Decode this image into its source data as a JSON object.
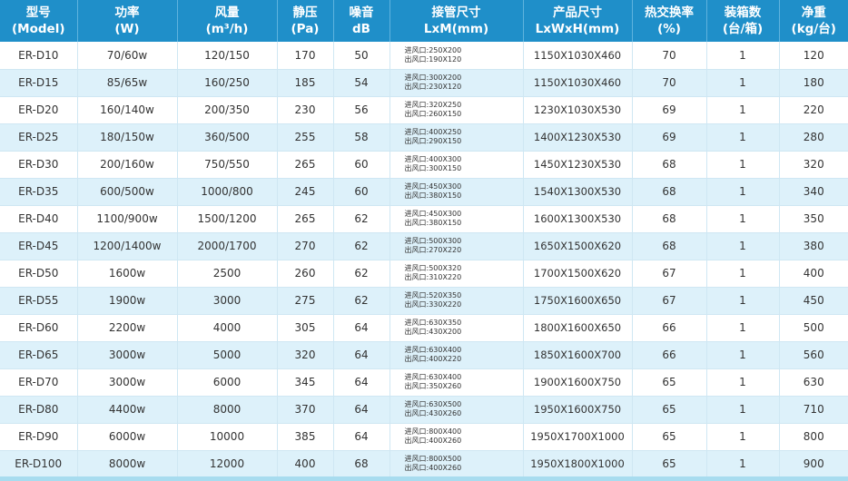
{
  "header": [
    {
      "top": "型号",
      "bottom": "(Model)"
    },
    {
      "top": "功率",
      "bottom": "(W)"
    },
    {
      "top": "风量",
      "bottom": "(m³/h)"
    },
    {
      "top": "静压",
      "bottom": "(Pa)"
    },
    {
      "top": "噪音",
      "bottom": "dB"
    },
    {
      "top": "接管尺寸",
      "bottom": "LxM(mm)"
    },
    {
      "top": "产品尺寸",
      "bottom": "LxWxH(mm)"
    },
    {
      "top": "热交换率",
      "bottom": "(%)"
    },
    {
      "top": "装箱数",
      "bottom": "(台/箱)"
    },
    {
      "top": "净重",
      "bottom": "(kg/台)"
    }
  ],
  "rows": [
    {
      "model": "ER-D10",
      "power": "70/60w",
      "airflow": "120/150",
      "pressure": "170",
      "noise": "50",
      "inlet": "进风口:250X200",
      "outlet": "出风口:190X120",
      "size": "1150X1030X460",
      "efficiency": "70",
      "pack": "1",
      "weight": "120"
    },
    {
      "model": "ER-D15",
      "power": "85/65w",
      "airflow": "160/250",
      "pressure": "185",
      "noise": "54",
      "inlet": "进风口:300X200",
      "outlet": "出风口:230X120",
      "size": "1150X1030X460",
      "efficiency": "70",
      "pack": "1",
      "weight": "180"
    },
    {
      "model": "ER-D20",
      "power": "160/140w",
      "airflow": "200/350",
      "pressure": "230",
      "noise": "56",
      "inlet": "进风口:320X250",
      "outlet": "出风口:260X150",
      "size": "1230X1030X530",
      "efficiency": "69",
      "pack": "1",
      "weight": "220"
    },
    {
      "model": "ER-D25",
      "power": "180/150w",
      "airflow": "360/500",
      "pressure": "255",
      "noise": "58",
      "inlet": "进风口:400X250",
      "outlet": "出风口:290X150",
      "size": "1400X1230X530",
      "efficiency": "69",
      "pack": "1",
      "weight": "280"
    },
    {
      "model": "ER-D30",
      "power": "200/160w",
      "airflow": "750/550",
      "pressure": "265",
      "noise": "60",
      "inlet": "进风口:400X300",
      "outlet": "出风口:300X150",
      "size": "1450X1230X530",
      "efficiency": "68",
      "pack": "1",
      "weight": "320"
    },
    {
      "model": "ER-D35",
      "power": "600/500w",
      "airflow": "1000/800",
      "pressure": "245",
      "noise": "60",
      "inlet": "进风口:450X300",
      "outlet": "出风口:380X150",
      "size": "1540X1300X530",
      "efficiency": "68",
      "pack": "1",
      "weight": "340"
    },
    {
      "model": "ER-D40",
      "power": "1100/900w",
      "airflow": "1500/1200",
      "pressure": "265",
      "noise": "62",
      "inlet": "进风口:450X300",
      "outlet": "出风口:380X150",
      "size": "1600X1300X530",
      "efficiency": "68",
      "pack": "1",
      "weight": "350"
    },
    {
      "model": "ER-D45",
      "power": "1200/1400w",
      "airflow": "2000/1700",
      "pressure": "270",
      "noise": "62",
      "inlet": "进风口:500X300",
      "outlet": "出风口:270X220",
      "size": "1650X1500X620",
      "efficiency": "68",
      "pack": "1",
      "weight": "380"
    },
    {
      "model": "ER-D50",
      "power": "1600w",
      "airflow": "2500",
      "pressure": "260",
      "noise": "62",
      "inlet": "进风口:500X320",
      "outlet": "出风口:310X220",
      "size": "1700X1500X620",
      "efficiency": "67",
      "pack": "1",
      "weight": "400"
    },
    {
      "model": "ER-D55",
      "power": "1900w",
      "airflow": "3000",
      "pressure": "275",
      "noise": "62",
      "inlet": "进风口:520X350",
      "outlet": "出风口:330X220",
      "size": "1750X1600X650",
      "efficiency": "67",
      "pack": "1",
      "weight": "450"
    },
    {
      "model": "ER-D60",
      "power": "2200w",
      "airflow": "4000",
      "pressure": "305",
      "noise": "64",
      "inlet": "进风口:630X350",
      "outlet": "出风口:430X200",
      "size": "1800X1600X650",
      "efficiency": "66",
      "pack": "1",
      "weight": "500"
    },
    {
      "model": "ER-D65",
      "power": "3000w",
      "airflow": "5000",
      "pressure": "320",
      "noise": "64",
      "inlet": "进风口:630X400",
      "outlet": "出风口:400X220",
      "size": "1850X1600X700",
      "efficiency": "66",
      "pack": "1",
      "weight": "560"
    },
    {
      "model": "ER-D70",
      "power": "3000w",
      "airflow": "6000",
      "pressure": "345",
      "noise": "64",
      "inlet": "进风口:630X400",
      "outlet": "出风口:350X260",
      "size": "1900X1600X750",
      "efficiency": "65",
      "pack": "1",
      "weight": "630"
    },
    {
      "model": "ER-D80",
      "power": "4400w",
      "airflow": "8000",
      "pressure": "370",
      "noise": "64",
      "inlet": "进风口:630X500",
      "outlet": "出风口:430X260",
      "size": "1950X1600X750",
      "efficiency": "65",
      "pack": "1",
      "weight": "710"
    },
    {
      "model": "ER-D90",
      "power": "6000w",
      "airflow": "10000",
      "pressure": "385",
      "noise": "64",
      "inlet": "进风口:800X400",
      "outlet": "出风口:400X260",
      "size": "1950X1700X1000",
      "efficiency": "65",
      "pack": "1",
      "weight": "800"
    },
    {
      "model": "ER-D100",
      "power": "8000w",
      "airflow": "12000",
      "pressure": "400",
      "noise": "68",
      "inlet": "进风口:800X500",
      "outlet": "出风口:400X260",
      "size": "1950X1800X1000",
      "efficiency": "65",
      "pack": "1",
      "weight": "900"
    }
  ],
  "colors": {
    "header_bg": "#1f8fc9",
    "row_alt": "#ddf1fa",
    "text": "#333333"
  }
}
